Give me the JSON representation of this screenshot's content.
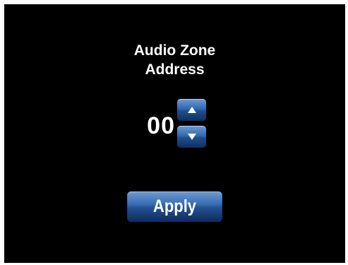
{
  "screen": {
    "title_line1": "Audio Zone",
    "title_line2": "Address",
    "value": "00",
    "up_icon": "triangle-up-icon",
    "down_icon": "triangle-down-icon",
    "apply_label": "Apply"
  },
  "colors": {
    "background": "#000000",
    "text": "#ffffff",
    "button_top": "#6f9cd6",
    "button_bottom": "#0f2f5e"
  }
}
